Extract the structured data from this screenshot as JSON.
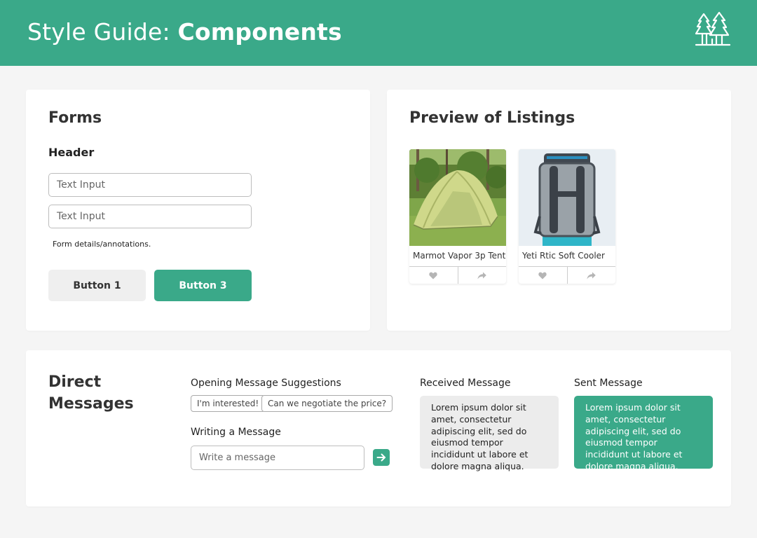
{
  "header": {
    "title_prefix": "Style Guide: ",
    "title_bold": "Components",
    "logo_icon": "pine-trees-logo-icon",
    "bg_color": "#3aa989"
  },
  "forms": {
    "title": "Forms",
    "header": "Header",
    "input1_placeholder": "Text Input",
    "input2_placeholder": "Text Input",
    "annotation": "Form details/annotations.",
    "button1_label": "Button 1",
    "button3_label": "Button 3"
  },
  "preview": {
    "title": "Preview of Listings",
    "listings": [
      {
        "title": "Marmot Vapor 3p Tent",
        "image": "tent-photo",
        "like_icon": "heart-icon",
        "share_icon": "share-icon"
      },
      {
        "title": "Yeti Rtic Soft Cooler",
        "image": "backpack-cooler-photo",
        "like_icon": "heart-icon",
        "share_icon": "share-icon"
      }
    ]
  },
  "direct_messages": {
    "title_line1": "Direct",
    "title_line2": "Messages",
    "suggestions_label": "Opening Message Suggestions",
    "suggestions": [
      "I'm interested!",
      "Can we negotiate the price?"
    ],
    "writing_label": "Writing a Message",
    "message_placeholder": "Write a message",
    "send_icon": "arrow-right-icon",
    "received_label": "Received Message",
    "received_text": "Lorem ipsum dolor sit amet, consectetur adipiscing elit, sed do eiusmod tempor incididunt ut labore et dolore magna aliqua.",
    "sent_label": "Sent Message",
    "sent_text": "Lorem ipsum dolor sit amet, consectetur adipiscing elit, sed do eiusmod tempor incididunt ut labore et dolore magna aliqua."
  },
  "colors": {
    "accent": "#3aa989",
    "page_bg": "#f5f5f5",
    "received_bubble": "#ececec",
    "button_grey": "#efefef"
  }
}
